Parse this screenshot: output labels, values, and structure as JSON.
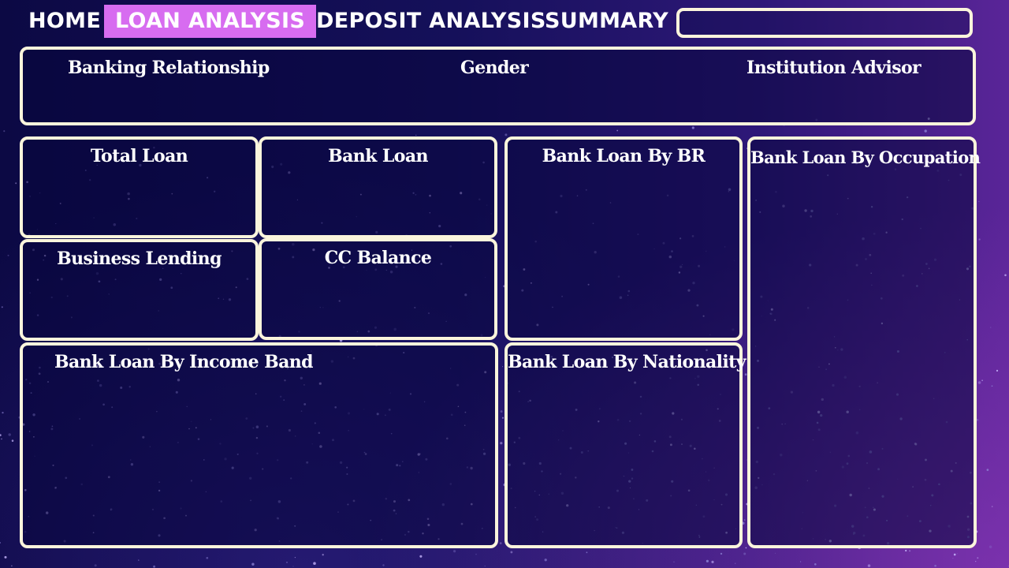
{
  "nav": {
    "home": "HOME",
    "loan_analysis": "LOAN ANALYSIS",
    "deposit_analysis": "DEPOSIT ANALYSIS",
    "summary": "SUMMARY",
    "active": "LOAN ANALYSIS"
  },
  "search": {
    "value": ""
  },
  "filters": {
    "banking_relationship": "Banking Relationship",
    "gender": "Gender",
    "institution_advisor": "Institution Advisor"
  },
  "panels": {
    "total_loan": "Total Loan",
    "bank_loan": "Bank Loan",
    "business_lending": "Business Lending",
    "cc_balance": "CC Balance",
    "bank_loan_by_br": "Bank Loan By BR",
    "bank_loan_by_occupation": "Bank Loan By Occupation",
    "bank_loan_by_income_band": "Bank Loan By Income Band",
    "bank_loan_by_nationality": "Bank Loan By Nationality"
  },
  "colors": {
    "active_tab": "#d76cf0",
    "border": "#fbf5dc",
    "background": "#15105a",
    "accent_purple": "#5a2598"
  }
}
